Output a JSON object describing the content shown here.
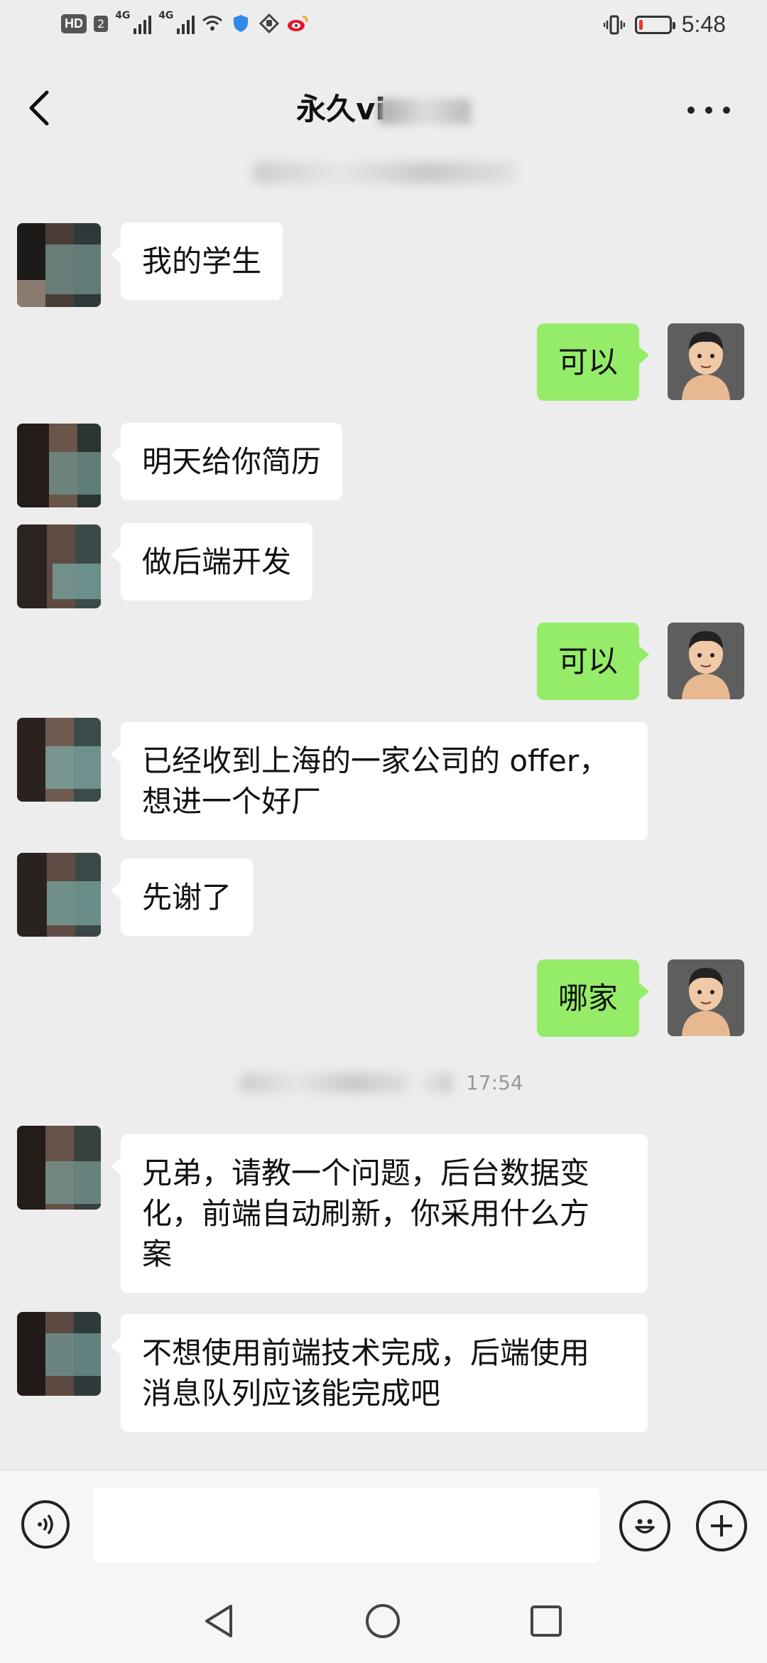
{
  "status_bar": {
    "hd": "HD",
    "sim": "2",
    "net1": "4G",
    "net2": "4G",
    "time": "5:48",
    "battery_level": 0.12,
    "battery_color": "#e53935"
  },
  "header": {
    "title": "永久vi"
  },
  "timestamp_bottom": "17:54",
  "messages": [
    {
      "side": "left",
      "text": "我的学生"
    },
    {
      "side": "right",
      "text": "可以"
    },
    {
      "side": "left",
      "text": "明天给你简历"
    },
    {
      "side": "left",
      "text": "做后端开发"
    },
    {
      "side": "right",
      "text": "可以"
    },
    {
      "side": "left",
      "line1": "已经收到上海的一家公司的 offer，",
      "line2": "想进一个好厂"
    },
    {
      "side": "left",
      "text": "先谢了"
    },
    {
      "side": "right",
      "text": "哪家"
    },
    {
      "side": "left",
      "line1": "兄弟，请教一个问题，后台数据变",
      "line2": "化，前端自动刷新，你采用什么方",
      "line3": "案"
    },
    {
      "side": "left",
      "line1": "不想使用前端技术完成，后端使用",
      "line2": "消息队列应该能完成吧"
    }
  ],
  "colors": {
    "background": "#ededed",
    "bubble_mine": "#95ec69",
    "bubble_other": "#ffffff"
  },
  "icons": {
    "back": "chevron-left-icon",
    "more": "more-dots-icon",
    "voice": "voice-icon",
    "emoji": "emoji-icon",
    "plus": "plus-icon",
    "nav_back": "triangle-back-icon",
    "nav_home": "circle-home-icon",
    "nav_recent": "square-recent-icon"
  }
}
